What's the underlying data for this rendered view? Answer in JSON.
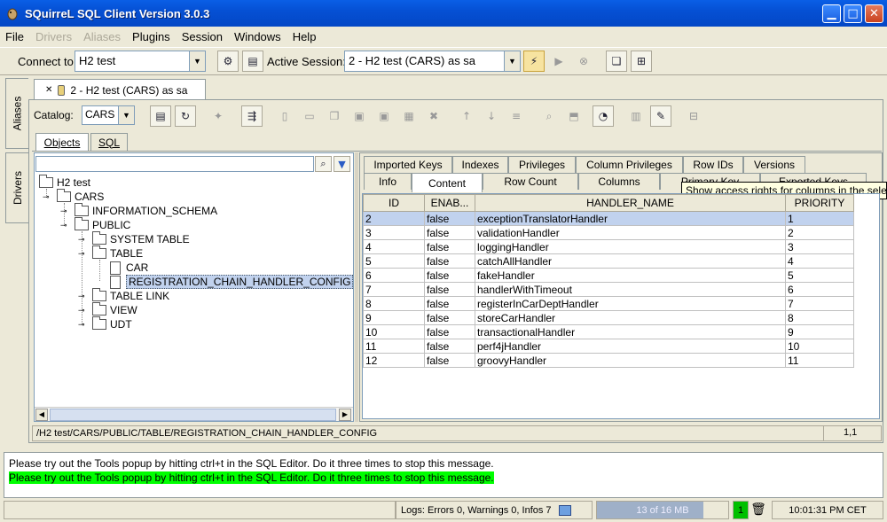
{
  "window": {
    "title": "SQuirreL SQL Client Version 3.0.3"
  },
  "menu": [
    {
      "label": "File",
      "enabled": true
    },
    {
      "label": "Drivers",
      "enabled": false
    },
    {
      "label": "Aliases",
      "enabled": false
    },
    {
      "label": "Plugins",
      "enabled": true
    },
    {
      "label": "Session",
      "enabled": true
    },
    {
      "label": "Windows",
      "enabled": true
    },
    {
      "label": "Help",
      "enabled": true
    }
  ],
  "connect_bar": {
    "connect_label": "Connect to:",
    "connect_value": "H2 test",
    "active_label": "Active Session:",
    "active_value": "2 - H2 test (CARS) as sa"
  },
  "side_tabs": {
    "aliases": "Aliases",
    "drivers": "Drivers"
  },
  "session_tab": {
    "close": "✕",
    "label": "2 - H2 test (CARS) as sa"
  },
  "catalog": {
    "label": "Catalog:",
    "value": "CARS"
  },
  "subtabs": {
    "objects": "Objects",
    "sql": "SQL"
  },
  "tree": {
    "h2": "H2 test",
    "cars": "CARS",
    "info_schema": "INFORMATION_SCHEMA",
    "public": "PUBLIC",
    "system_table": "SYSTEM TABLE",
    "table": "TABLE",
    "car": "CAR",
    "reg": "REGISTRATION_CHAIN_HANDLER_CONFIG",
    "table_link": "TABLE LINK",
    "view": "VIEW",
    "udt": "UDT"
  },
  "detail_tabs_row1": [
    "Imported Keys",
    "Indexes",
    "Privileges",
    "Column Privileges",
    "Row IDs",
    "Versions"
  ],
  "detail_tabs_row2": [
    "Info",
    "Content",
    "Row Count",
    "Columns",
    "Primary Key",
    "Exported Keys"
  ],
  "tooltip": "Show access rights for columns in the selected table",
  "grid": {
    "columns": [
      "ID",
      "ENAB...",
      "HANDLER_NAME",
      "PRIORITY"
    ],
    "rows": [
      [
        "2",
        "false",
        "exceptionTranslatorHandler",
        "1"
      ],
      [
        "3",
        "false",
        "validationHandler",
        "2"
      ],
      [
        "4",
        "false",
        "loggingHandler",
        "3"
      ],
      [
        "5",
        "false",
        "catchAllHandler",
        "4"
      ],
      [
        "6",
        "false",
        "fakeHandler",
        "5"
      ],
      [
        "7",
        "false",
        "handlerWithTimeout",
        "6"
      ],
      [
        "8",
        "false",
        "registerInCarDeptHandler",
        "7"
      ],
      [
        "9",
        "false",
        "storeCarHandler",
        "8"
      ],
      [
        "10",
        "false",
        "transactionalHandler",
        "9"
      ],
      [
        "11",
        "false",
        "perf4jHandler",
        "10"
      ],
      [
        "12",
        "false",
        "groovyHandler",
        "11"
      ]
    ]
  },
  "path": {
    "text": "/H2 test/CARS/PUBLIC/TABLE/REGISTRATION_CHAIN_HANDLER_CONFIG",
    "pos": "1,1"
  },
  "messages": {
    "line1": "Please try out the Tools popup by hitting ctrl+t in the SQL Editor. Do it three times to stop this message.",
    "line2": "Please try out the Tools popup by hitting ctrl+t in the SQL Editor. Do it three times to stop this message."
  },
  "status": {
    "logs": "Logs: Errors 0, Warnings 0, Infos 7",
    "memory": "13 of 16 MB",
    "memory_used_fraction": 0.81,
    "count": "1",
    "time": "10:01:31 PM CET"
  }
}
